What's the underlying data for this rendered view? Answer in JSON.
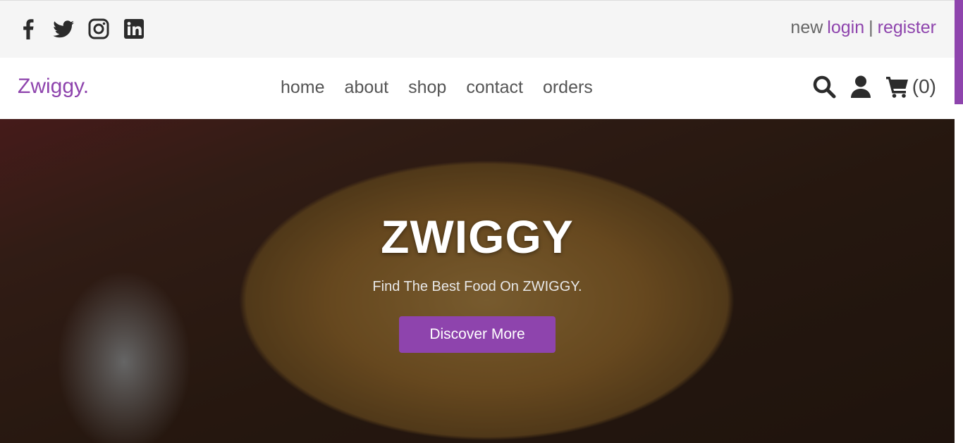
{
  "top_bar": {
    "social_icons": [
      "facebook-icon",
      "twitter-icon",
      "instagram-icon",
      "linkedin-icon"
    ],
    "auth": {
      "prefix": "new",
      "login": "login",
      "separator": "|",
      "register": "register"
    }
  },
  "header": {
    "logo": "Zwiggy.",
    "nav": [
      {
        "label": "home"
      },
      {
        "label": "about"
      },
      {
        "label": "shop"
      },
      {
        "label": "contact"
      },
      {
        "label": "orders"
      }
    ],
    "icons": [
      "search-icon",
      "user-icon",
      "cart-icon"
    ],
    "cart_count": "(0)"
  },
  "hero": {
    "title": "ZWIGGY",
    "subtitle": "Find The Best Food On ZWIGGY.",
    "button_label": "Discover More"
  },
  "colors": {
    "accent": "#8e44ad",
    "top_bar_bg": "#f5f5f5",
    "text_dark": "#2b2b2b",
    "nav_text": "#555555"
  }
}
